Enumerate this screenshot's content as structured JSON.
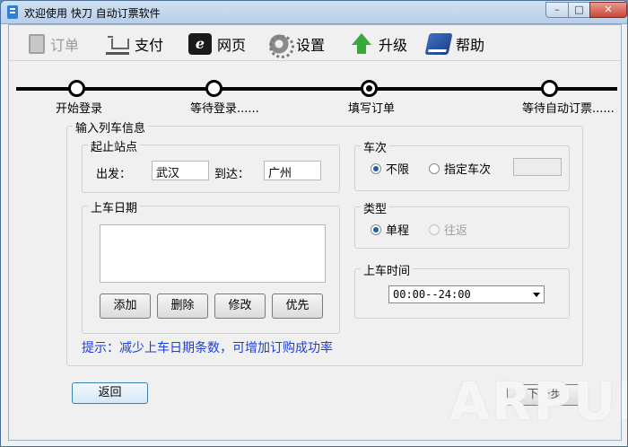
{
  "window": {
    "title": "欢迎使用 快刀 自动订票软件"
  },
  "toolbar": [
    {
      "label": "订单",
      "icon": "clipboard-icon",
      "disabled": true
    },
    {
      "label": "支付",
      "icon": "cart-icon"
    },
    {
      "label": "网页",
      "icon": "ie-browser-icon"
    },
    {
      "label": "设置",
      "icon": "gear-icon"
    },
    {
      "label": "升级",
      "icon": "up-arrow-icon"
    },
    {
      "label": "帮助",
      "icon": "help-book-icon"
    }
  ],
  "steps": [
    {
      "label": "开始登录",
      "state": "done"
    },
    {
      "label": "等待登录......",
      "state": "done"
    },
    {
      "label": "填写订单",
      "state": "current"
    },
    {
      "label": "等待自动订票......",
      "state": "pending"
    }
  ],
  "train_info": {
    "legend": "输入列车信息",
    "stations": {
      "legend": "起止站点",
      "from_label": "出发：",
      "from_value": "武汉",
      "to_label": "到达：",
      "to_value": "广州"
    },
    "date": {
      "legend": "上车日期",
      "buttons": [
        "添加",
        "删除",
        "修改",
        "优先"
      ]
    },
    "hint": "提示：减少上车日期条数，可增加订购成功率",
    "train_no": {
      "legend": "车次",
      "option_any": "不限",
      "option_specific": "指定车次",
      "selected": "不限",
      "specific_value": ""
    },
    "type": {
      "legend": "类型",
      "option_oneway": "单程",
      "option_round": "往返",
      "selected": "单程"
    },
    "time": {
      "legend": "上车时间",
      "value": "00:00--24:00"
    }
  },
  "footer": {
    "back": "返回",
    "next": "下一步"
  },
  "watermark": "ARPUN",
  "colors": {
    "hint": "#1f3fd4",
    "titlebar": "#cfe0f2"
  }
}
